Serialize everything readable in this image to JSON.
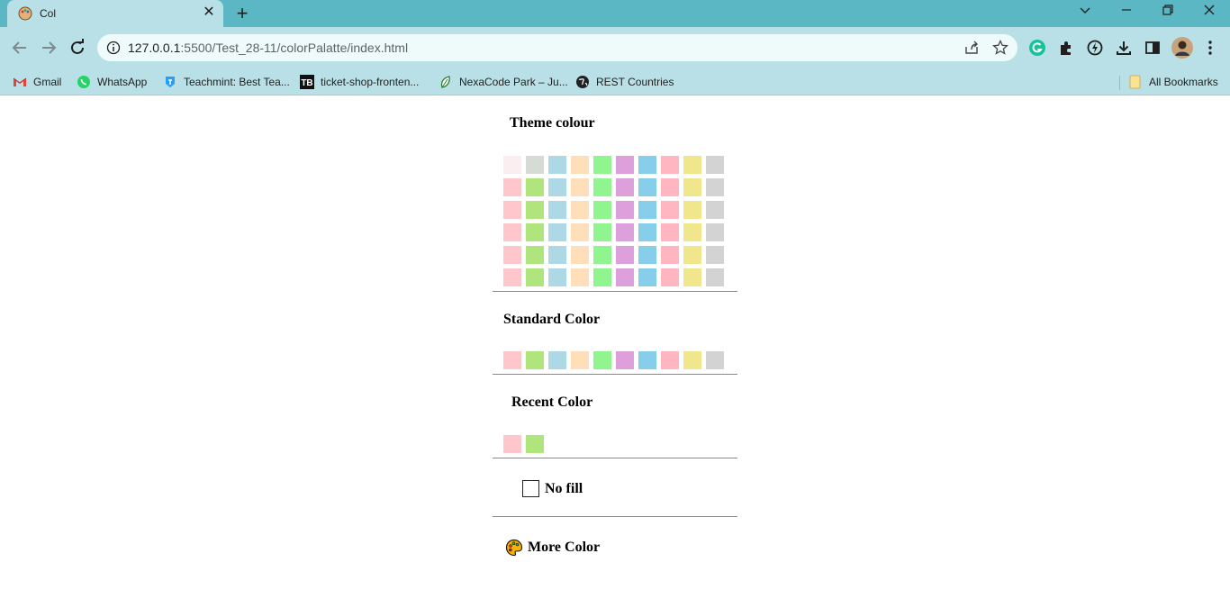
{
  "browser": {
    "tab_title": "Col",
    "url_host": "127.0.0.1",
    "url_rest": ":5500/Test_28-11/colorPalatte/index.html",
    "bookmarks": [
      {
        "label": "Gmail",
        "icon": "gmail-icon"
      },
      {
        "label": "WhatsApp",
        "icon": "whatsapp-icon"
      },
      {
        "label": "Teachmint: Best Tea...",
        "icon": "teachmint-icon"
      },
      {
        "label": "ticket-shop-fronten...",
        "icon": "tb-icon"
      },
      {
        "label": "NexaCode Park – Ju...",
        "icon": "leaf-icon"
      },
      {
        "label": "REST Countries",
        "icon": "globe-icon"
      }
    ],
    "all_bookmarks": "All Bookmarks"
  },
  "palette": {
    "theme_title": "Theme colour",
    "theme_first_row": [
      "#fbeef0",
      "#d7dbd5",
      "#add8e6",
      "#ffdfba",
      "#90f48f",
      "#dda0dd",
      "#87ceeb",
      "#ffb6c1",
      "#f0e68c",
      "#d3d3d3"
    ],
    "theme_rows": [
      "#ffc7cb",
      "#b0e57d",
      "#add8e6",
      "#ffdfba",
      "#90f48f",
      "#dda0dd",
      "#87ceeb",
      "#ffb6c1",
      "#f0e68c",
      "#d3d3d3"
    ],
    "theme_row_count": 5,
    "standard_title": "Standard Color",
    "standard_colors": [
      "#ffc7cb",
      "#b0e57d",
      "#add8e6",
      "#ffdfba",
      "#90f48f",
      "#dda0dd",
      "#87ceeb",
      "#ffb6c1",
      "#f0e68c",
      "#d3d3d3"
    ],
    "recent_title": "Recent Color",
    "recent_colors": [
      "#ffc7cb",
      "#b0e57d",
      "#ffffff"
    ],
    "no_fill_label": "No fill",
    "more_color_label": "More Color"
  }
}
